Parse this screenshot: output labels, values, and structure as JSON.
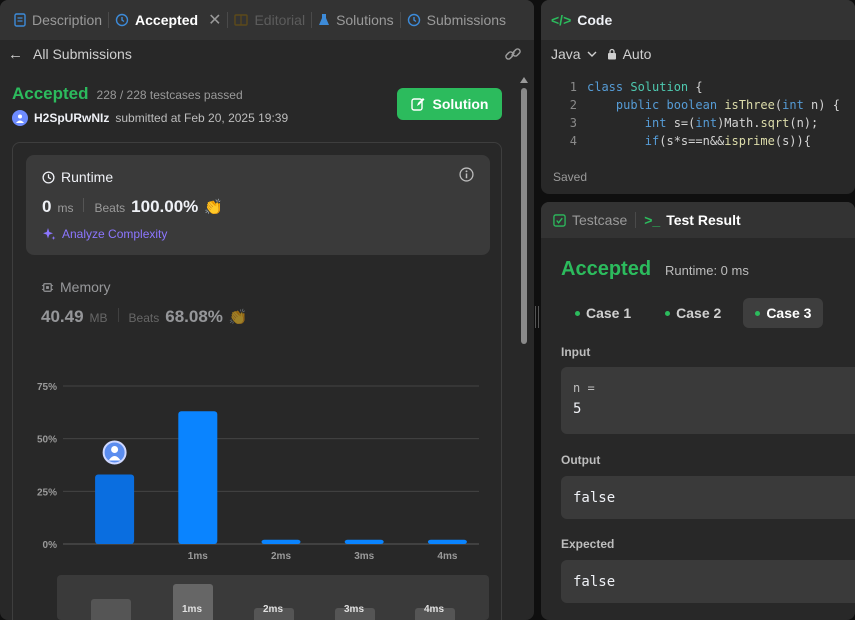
{
  "tabs": {
    "description": "Description",
    "accepted": "Accepted",
    "editorial": "Editorial",
    "solutions": "Solutions",
    "submissions": "Submissions"
  },
  "subheader": {
    "back_label": "All Submissions"
  },
  "submission": {
    "status": "Accepted",
    "testcases": "228 / 228 testcases passed",
    "username": "H2SpURwNIz",
    "submitted_text": "submitted at Feb 20, 2025 19:39",
    "solution_button": "Solution"
  },
  "runtime": {
    "title": "Runtime",
    "value": "0",
    "unit": "ms",
    "beats_label": "Beats",
    "beats_value": "100.00%",
    "analyze_label": "Analyze Complexity"
  },
  "memory": {
    "title": "Memory",
    "value": "40.49",
    "unit": "MB",
    "beats_label": "Beats",
    "beats_value": "68.08%"
  },
  "chart_data": {
    "type": "bar",
    "categories": [
      "",
      "1ms",
      "2ms",
      "3ms",
      "4ms"
    ],
    "values": [
      33,
      63,
      2,
      2,
      2
    ],
    "ytick_labels": [
      "75%",
      "50%",
      "25%",
      "0%"
    ],
    "ylim": [
      0,
      75
    ],
    "highlighted_index": 0,
    "grid": true
  },
  "mini_chart": {
    "labels": [
      "1ms",
      "2ms",
      "3ms",
      "4ms"
    ]
  },
  "code": {
    "title": "Code",
    "language": "Java",
    "mode": "Auto",
    "status": "Saved",
    "lines": [
      {
        "num": "1",
        "text": "class Solution {"
      },
      {
        "num": "2",
        "text": "    public boolean isThree(int n) {"
      },
      {
        "num": "3",
        "text": "        int s=(int)Math.sqrt(n);"
      },
      {
        "num": "4",
        "text": "        if(s*s==n&&isprime(s)){"
      }
    ]
  },
  "result": {
    "tab_testcase": "Testcase",
    "tab_result": "Test Result",
    "status": "Accepted",
    "runtime": "Runtime: 0 ms",
    "cases": [
      "Case 1",
      "Case 2",
      "Case 3"
    ],
    "input_label": "Input",
    "input_var": "n =",
    "input_value": "5",
    "output_label": "Output",
    "output_value": "false",
    "expected_label": "Expected",
    "expected_value": "false"
  },
  "colors": {
    "accent_green": "#2cbb5d",
    "bar_blue": "#0a84ff",
    "bar_highlight": "#0a6ee0",
    "purple": "#8c76ff"
  }
}
